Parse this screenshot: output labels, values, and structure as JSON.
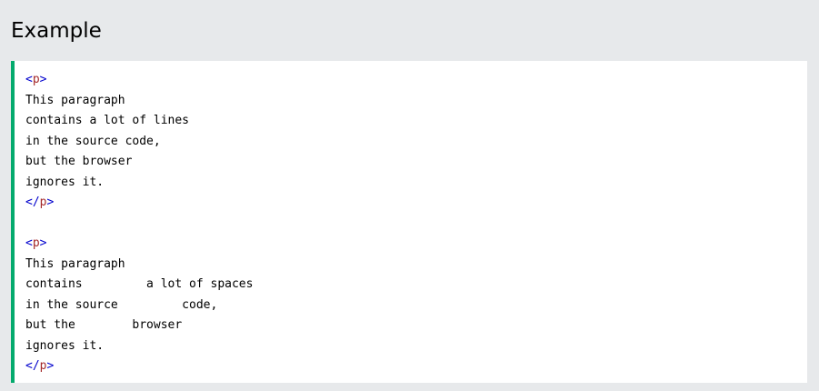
{
  "heading": "Example",
  "code": {
    "tag_open_bracket": "<",
    "tag_close_open_bracket": "</",
    "tag_end_bracket": ">",
    "tag_name": "p",
    "paragraph1": [
      "This paragraph",
      "contains a lot of lines",
      "in the source code,",
      "but the browser",
      "ignores it."
    ],
    "paragraph2": [
      "This paragraph",
      "contains         a lot of spaces",
      "in the source         code,",
      "but the        browser",
      "ignores it."
    ]
  },
  "colors": {
    "accent": "#04aa6d",
    "tag_bracket": "#0000cd",
    "tag_name": "#a52a2a",
    "page_background": "#e7e9eb",
    "code_background": "#ffffff"
  }
}
